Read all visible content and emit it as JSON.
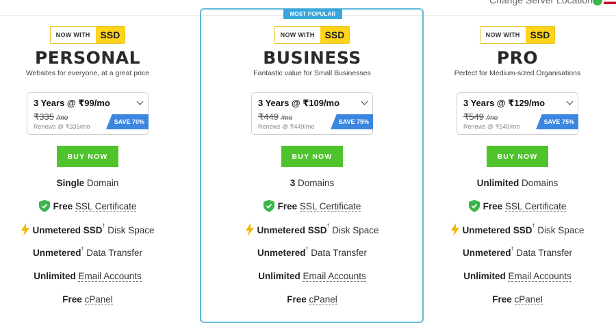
{
  "header": {
    "server_location": "Change Server Location"
  },
  "business_badge": "MOST POPULAR",
  "badge": {
    "now_with": "NOW WITH",
    "ssd": "SSD"
  },
  "buy_label": "BUY NOW",
  "colors": {
    "green": "#4ec32c",
    "blue_save": "#3a86e0",
    "popular": "#39a7dc",
    "ssd_yellow": "#ffd31c",
    "border_popular": "#62b9dd"
  },
  "plans": [
    {
      "name": "PERSONAL",
      "desc": "Websites for everyone, at a great price",
      "term_price": "3 Years @ ₹99/mo",
      "old_price": "₹335",
      "mo": "/mo",
      "renew": "Renews @ ₹335/mo",
      "save": "SAVE 70%",
      "features": {
        "domain_bold": "Single",
        "domain_text": " Domain",
        "ssl_bold": "Free",
        "ssl_text": "SSL Certificate",
        "disk_bold": "Unmetered SSD",
        "disk_text": " Disk Space",
        "transfer_bold": "Unmetered",
        "transfer_text": " Data Transfer",
        "email_bold": "Unlimited",
        "email_text": "Email Accounts",
        "cpanel_bold": "Free",
        "cpanel_text": "cPanel"
      }
    },
    {
      "name": "BUSINESS",
      "desc": "Fantastic value for Small Businesses",
      "term_price": "3 Years @ ₹109/mo",
      "old_price": "₹449",
      "mo": "/mo",
      "renew": "Renews @ ₹449/mo",
      "save": "SAVE 75%",
      "features": {
        "domain_bold": "3",
        "domain_text": " Domains",
        "ssl_bold": "Free",
        "ssl_text": "SSL Certificate",
        "disk_bold": "Unmetered SSD",
        "disk_text": " Disk Space",
        "transfer_bold": "Unmetered",
        "transfer_text": " Data Transfer",
        "email_bold": "Unlimited",
        "email_text": "Email Accounts",
        "cpanel_bold": "Free",
        "cpanel_text": "cPanel"
      }
    },
    {
      "name": "PRO",
      "desc": "Perfect for Medium-sized Organisations",
      "term_price": "3 Years @ ₹129/mo",
      "old_price": "₹549",
      "mo": "/mo",
      "renew": "Renews @ ₹549/mo",
      "save": "SAVE 75%",
      "features": {
        "domain_bold": "Unlimited",
        "domain_text": " Domains",
        "ssl_bold": "Free",
        "ssl_text": "SSL Certificate",
        "disk_bold": "Unmetered SSD",
        "disk_text": " Disk Space",
        "transfer_bold": "Unmetered",
        "transfer_text": " Data Transfer",
        "email_bold": "Unlimited",
        "email_text": "Email Accounts",
        "cpanel_bold": "Free",
        "cpanel_text": "cPanel"
      }
    }
  ],
  "icons": {
    "ssl": "shield-check-icon",
    "disk": "lightning-icon",
    "dropdown": "chevron-down-icon"
  }
}
